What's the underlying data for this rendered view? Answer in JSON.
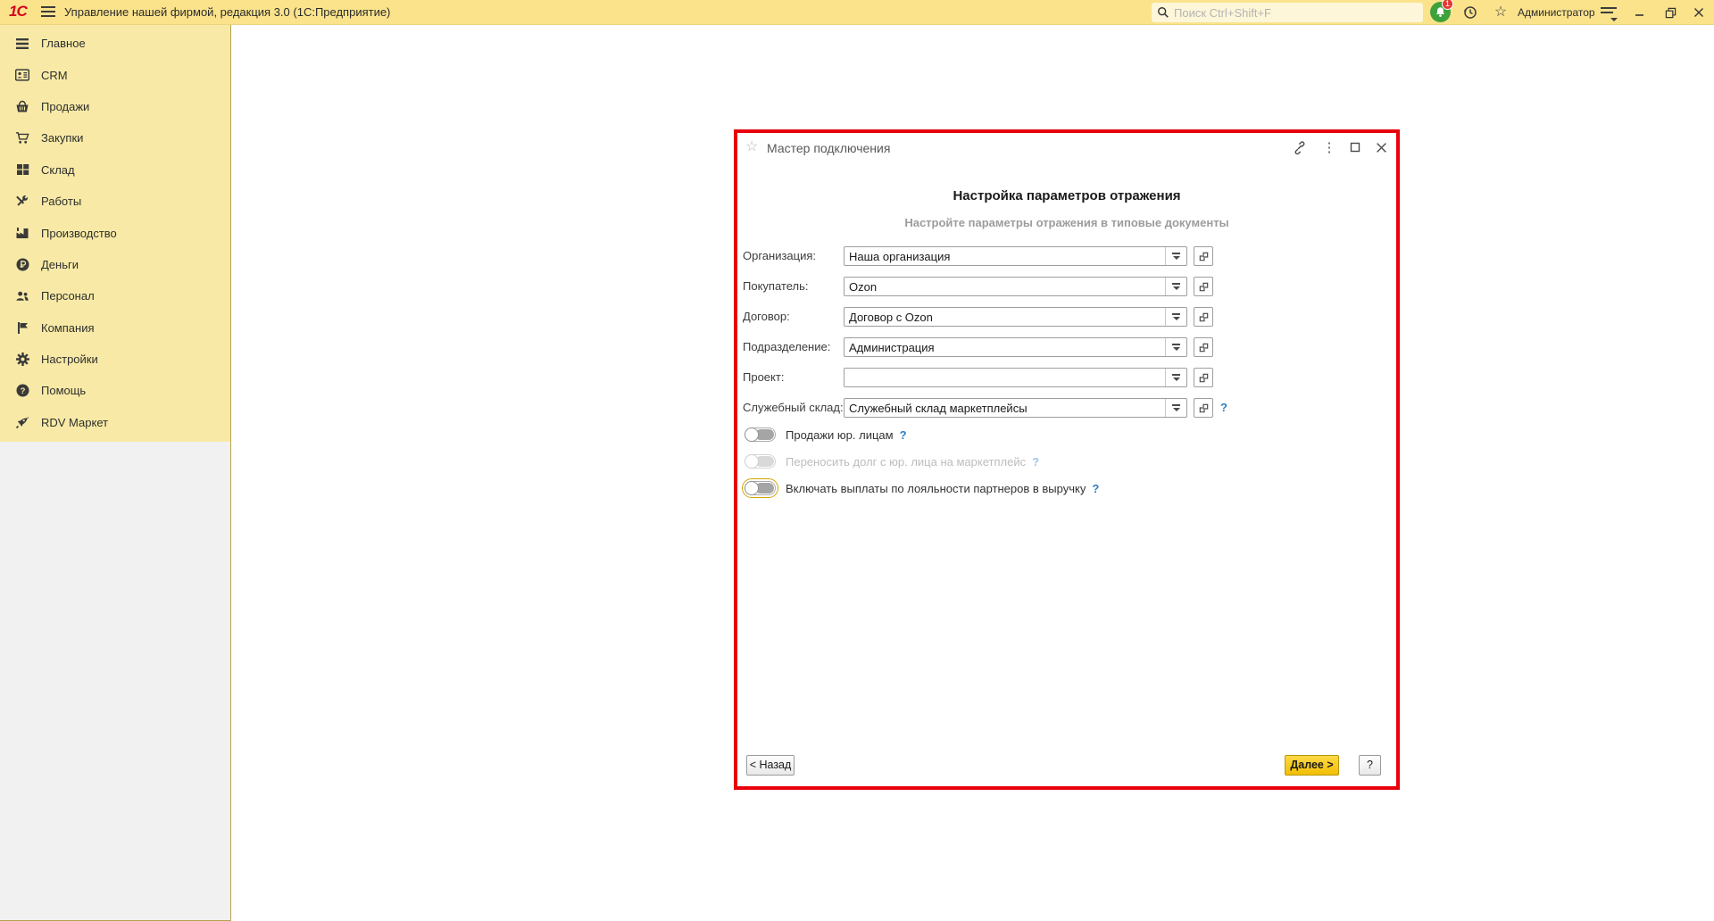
{
  "topbar": {
    "title": "Управление нашей фирмой, редакция 3.0  (1С:Предприятие)",
    "logo": "1С",
    "search_placeholder": "Поиск Ctrl+Shift+F",
    "notification_count": "1",
    "user": "Администратор"
  },
  "sidebar": {
    "items": [
      {
        "label": "Главное",
        "icon": "menu-lines-icon"
      },
      {
        "label": "CRM",
        "icon": "contact-card-icon"
      },
      {
        "label": "Продажи",
        "icon": "basket-icon"
      },
      {
        "label": "Закупки",
        "icon": "cart-icon"
      },
      {
        "label": "Склад",
        "icon": "boxes-icon"
      },
      {
        "label": "Работы",
        "icon": "tools-icon"
      },
      {
        "label": "Производство",
        "icon": "factory-icon"
      },
      {
        "label": "Деньги",
        "icon": "ruble-coin-icon"
      },
      {
        "label": "Персонал",
        "icon": "people-icon"
      },
      {
        "label": "Компания",
        "icon": "flag-icon"
      },
      {
        "label": "Настройки",
        "icon": "gear-icon"
      },
      {
        "label": "Помощь",
        "icon": "question-circle-icon"
      },
      {
        "label": "RDV Маркет",
        "icon": "rocket-icon"
      }
    ]
  },
  "dialog": {
    "title": "Мастер подключения",
    "heading": "Настройка параметров отражения",
    "subheading": "Настройте параметры отражения в типовые документы",
    "fields": [
      {
        "label": "Организация:",
        "value": "Наша организация",
        "help": false
      },
      {
        "label": "Покупатель:",
        "value": "Ozon",
        "help": false
      },
      {
        "label": "Договор:",
        "value": "Договор с Ozon",
        "help": false
      },
      {
        "label": "Подразделение:",
        "value": "Администрация",
        "help": false
      },
      {
        "label": "Проект:",
        "value": "",
        "help": false
      },
      {
        "label": "Служебный склад:",
        "value": "Служебный склад маркетплейсы",
        "help": true
      }
    ],
    "help_mark": "?",
    "toggles": [
      {
        "label": "Продажи юр. лицам",
        "state": "off",
        "disabled": false,
        "focused": false
      },
      {
        "label": "Переносить долг с юр. лица на маркетплейс",
        "state": "off",
        "disabled": true,
        "focused": false
      },
      {
        "label": "Включать выплаты по лояльности партнеров в выручку",
        "state": "off",
        "disabled": false,
        "focused": true
      }
    ],
    "footer": {
      "back": "< Назад",
      "next": "Далее >",
      "help": "?"
    }
  },
  "colors": {
    "topbar_bg": "#fbe38c",
    "sidebar_bg": "#f8eaa6",
    "sidebar_lower_bg": "#f1f1f1",
    "panel_border": "#b3a14e",
    "dialog_border": "#e8000d",
    "next_button_bg": "#f2c00a",
    "help_blue": "#2e7fc1",
    "bell_green": "#3da13d",
    "badge_red": "#e53935"
  }
}
